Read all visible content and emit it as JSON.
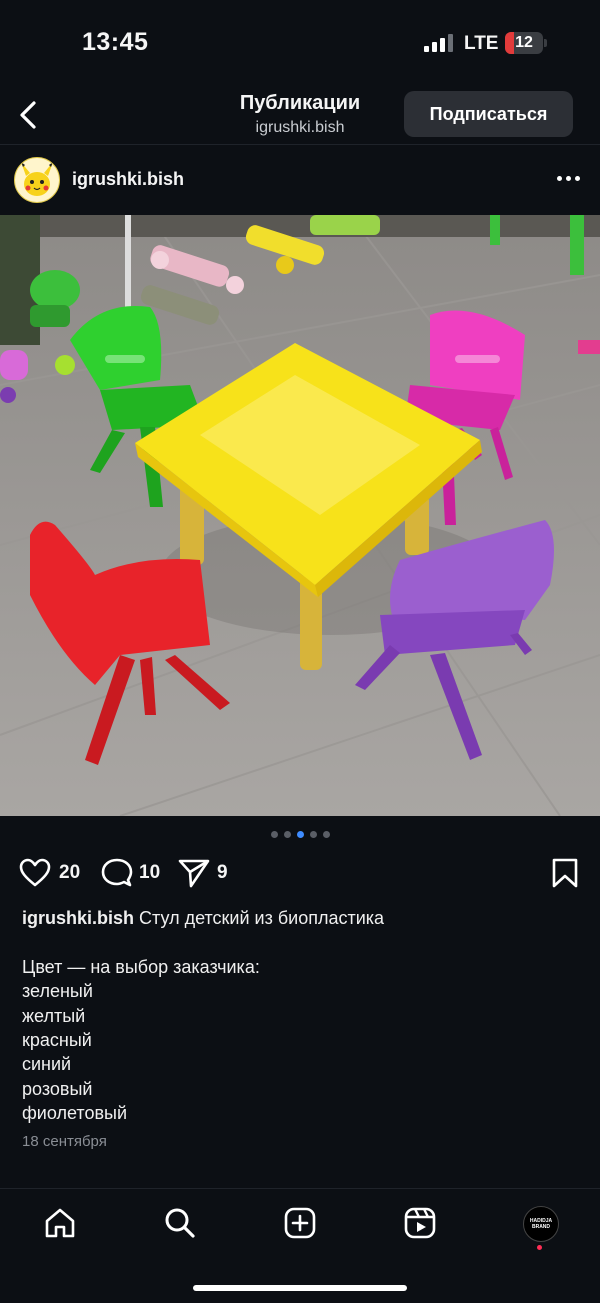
{
  "status_bar": {
    "time": "13:45",
    "network": "LTE",
    "battery": "12"
  },
  "header": {
    "title": "Публикации",
    "subtitle": "igrushki.bish",
    "follow_label": "Подписаться"
  },
  "post": {
    "username": "igrushki.bish",
    "avatar_icon": "pikachu-avatar",
    "likes": "20",
    "comments": "10",
    "shares": "9",
    "carousel": {
      "count": 5,
      "active": 2
    },
    "caption": {
      "username": "igrushki.bish",
      "title": " Стул детский из биопластика",
      "intro": "Цвет — на выбор заказчика:",
      "colors": [
        "зеленый",
        "желтый",
        "красный",
        "синий",
        "розовый",
        "фиолетовый"
      ]
    },
    "date": "18 сентября"
  },
  "bottom_nav": {
    "items": [
      "home-icon",
      "search-icon",
      "create-icon",
      "reels-icon",
      "profile-avatar"
    ],
    "profile_text": "HADIDJA BRAND"
  },
  "colors": {
    "background": "#0c0f14",
    "accent": "#3f8cff",
    "notification": "#ff2d55"
  }
}
